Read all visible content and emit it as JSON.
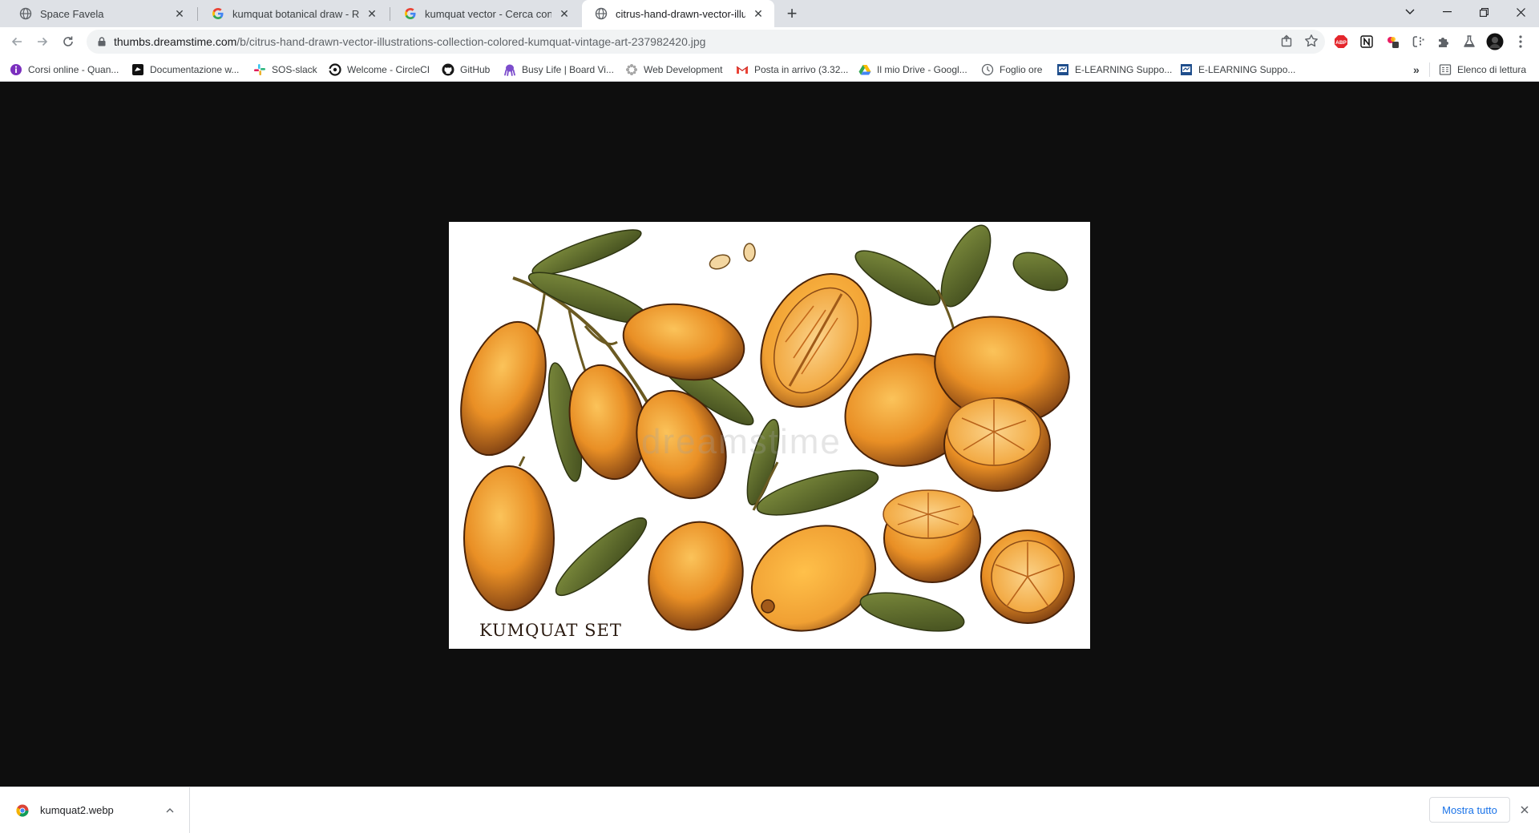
{
  "tabs": [
    {
      "title": "Space Favela",
      "icon": "globe-icon"
    },
    {
      "title": "kumquat botanical draw - Ricerca Google",
      "icon": "google-icon"
    },
    {
      "title": "kumquat vector - Cerca con Google",
      "icon": "google-icon"
    },
    {
      "title": "citrus-hand-drawn-vector-illustrations",
      "icon": "globe-icon",
      "active": true
    }
  ],
  "toolbar": {
    "url_host": "thumbs.dreamstime.com",
    "url_path": "/b/citrus-hand-drawn-vector-illustrations-collection-colored-kumquat-vintage-art-237982420.jpg"
  },
  "bookmarks": [
    {
      "label": "Corsi online - Quan...",
      "icon": "info-circle-icon"
    },
    {
      "label": "Documentazione w...",
      "icon": "doc-bird-icon"
    },
    {
      "label": "SOS-slack",
      "icon": "slack-icon"
    },
    {
      "label": "Welcome - CircleCI",
      "icon": "circleci-icon"
    },
    {
      "label": "GitHub",
      "icon": "github-icon"
    },
    {
      "label": "Busy Life | Board Vi...",
      "icon": "octopus-icon"
    },
    {
      "label": "Web Development",
      "icon": "gear-flower-icon"
    },
    {
      "label": "Posta in arrivo (3.32...",
      "icon": "gmail-icon"
    },
    {
      "label": "Il mio Drive - Googl...",
      "icon": "drive-icon"
    },
    {
      "label": "Foglio ore",
      "icon": "clock-icon"
    },
    {
      "label": "E-LEARNING Suppo...",
      "icon": "elearning-icon"
    },
    {
      "label": "E-LEARNING Suppo...",
      "icon": "elearning-icon"
    }
  ],
  "reading_list_label": "Elenco di lettura",
  "image": {
    "caption": "KUMQUAT SET",
    "watermark": "dreamstime"
  },
  "download_shelf": {
    "filename": "kumquat2.webp",
    "show_all_label": "Mostra tutto"
  },
  "colors": {
    "tabstrip": "#dee1e6",
    "content_bg": "#0e0e0e",
    "fruit_orange": "#f2a33a",
    "fruit_dark": "#7a3d12",
    "leaf_green": "#5b6b2c",
    "link_blue": "#1a73e8"
  }
}
